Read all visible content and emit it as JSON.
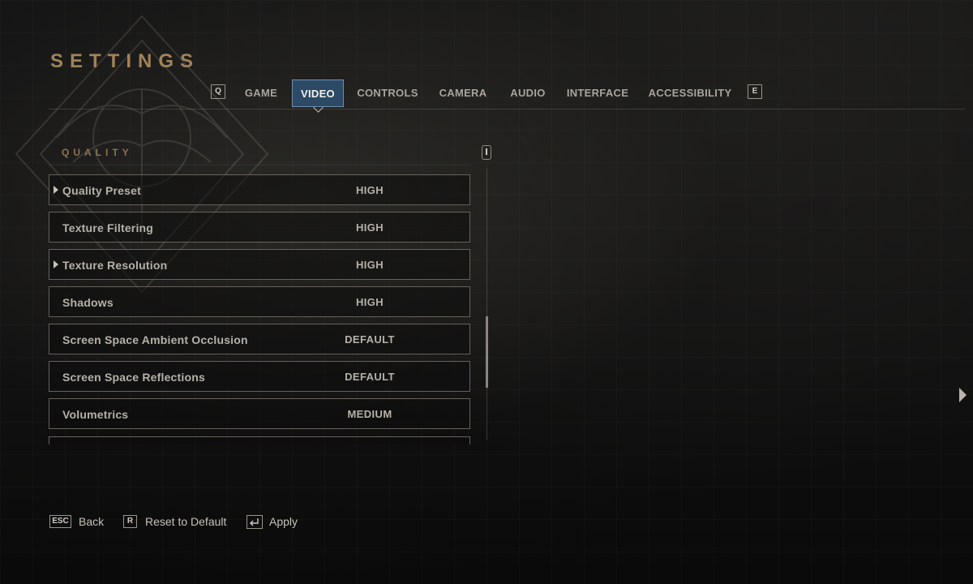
{
  "header": {
    "title": "SETTINGS"
  },
  "tabs": {
    "prev_key": "Q",
    "next_key": "E",
    "items": [
      {
        "label": "GAME",
        "active": false
      },
      {
        "label": "VIDEO",
        "active": true
      },
      {
        "label": "CONTROLS",
        "active": false
      },
      {
        "label": "CAMERA",
        "active": false
      },
      {
        "label": "AUDIO",
        "active": false
      },
      {
        "label": "INTERFACE",
        "active": false
      },
      {
        "label": "ACCESSIBILITY",
        "active": false
      }
    ]
  },
  "section": {
    "title": "QUALITY"
  },
  "settings": [
    {
      "label": "Quality Preset",
      "value": "HIGH",
      "expandable": true
    },
    {
      "label": "Texture Filtering",
      "value": "HIGH",
      "expandable": false
    },
    {
      "label": "Texture Resolution",
      "value": "HIGH",
      "expandable": true
    },
    {
      "label": "Shadows",
      "value": "HIGH",
      "expandable": false
    },
    {
      "label": "Screen Space Ambient Occlusion",
      "value": "DEFAULT",
      "expandable": false
    },
    {
      "label": "Screen Space Reflections",
      "value": "DEFAULT",
      "expandable": false
    },
    {
      "label": "Volumetrics",
      "value": "MEDIUM",
      "expandable": false
    }
  ],
  "footer": {
    "back_key": "ESC",
    "back_label": "Back",
    "reset_key": "R",
    "reset_label": "Reset to Default",
    "apply_label": "Apply"
  },
  "colors": {
    "accent_gold": "#a0825a",
    "active_tab_bg": "#2c4a66",
    "row_border": "#66625b"
  }
}
